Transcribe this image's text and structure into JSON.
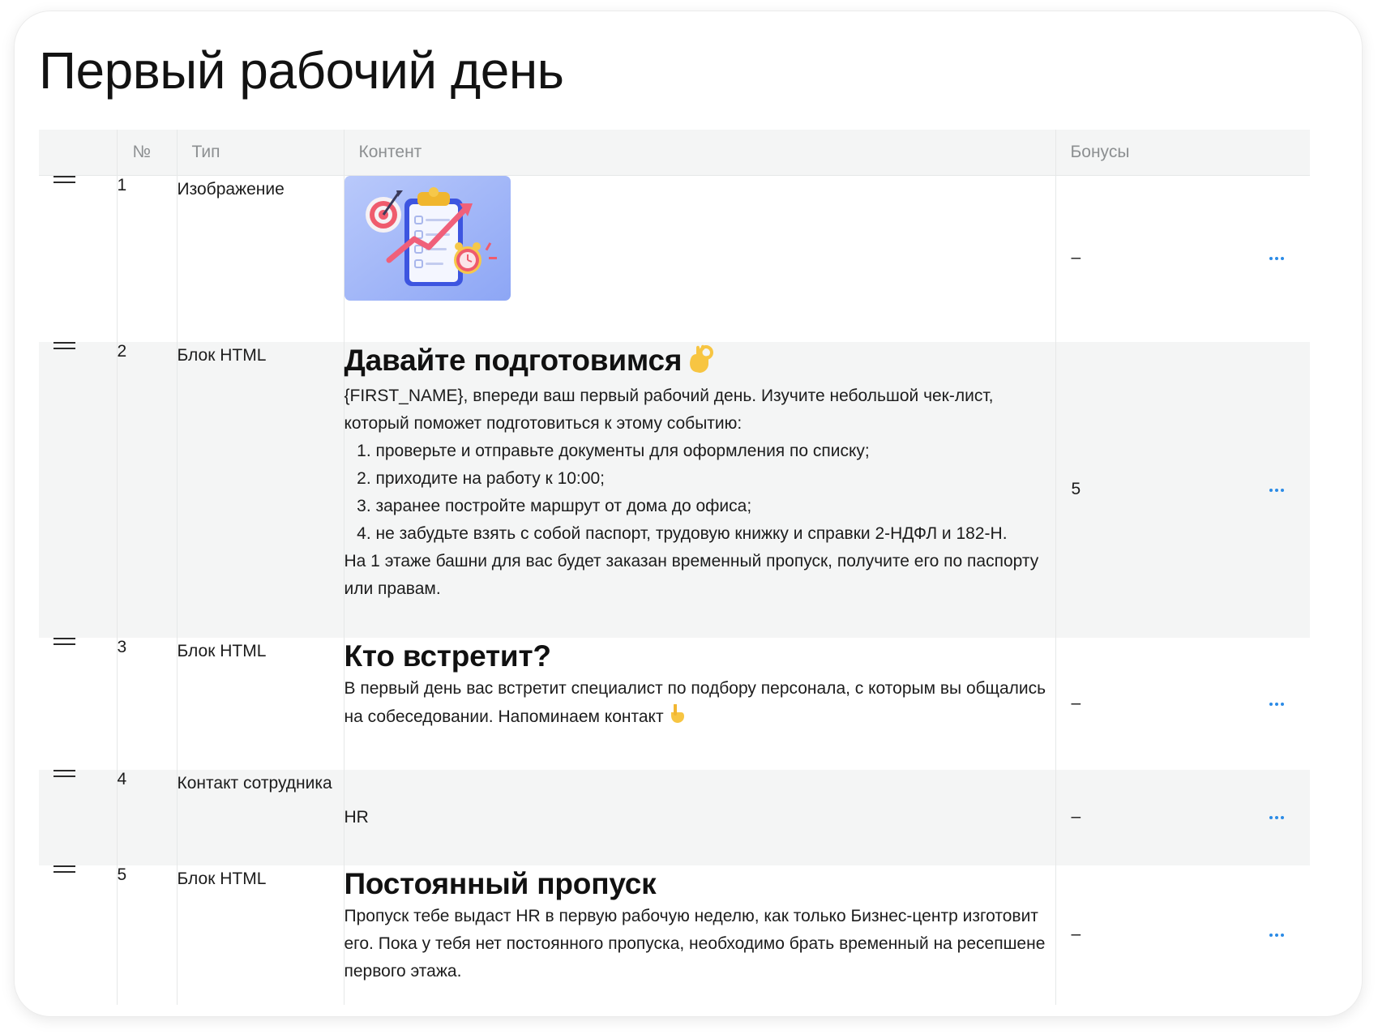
{
  "page": {
    "title": "Первый рабочий день"
  },
  "table": {
    "headers": {
      "num": "№",
      "type": "Тип",
      "content": "Контент",
      "bonuses": "Бонусы"
    },
    "rows": [
      {
        "num": "1",
        "type": "Изображение",
        "content_kind": "image",
        "image": "checklist-target-illustration",
        "bonus": "–"
      },
      {
        "num": "2",
        "type": "Блок HTML",
        "content_kind": "html",
        "title": "Давайте подготовимся",
        "title_emoji": "ok-hand-emoji",
        "intro": "{FIRST_NAME}, впереди ваш первый рабочий день. Изучите небольшой чек-лист, который поможет подготовиться к этому событию:",
        "list": [
          "проверьте и отправьте документы для оформления по списку;",
          "приходите на работу к 10:00;",
          "заранее постройте маршрут от дома до офиса;",
          "не забудьте взять с собой паспорт, трудовую книжку и справки 2-НДФЛ и 182-Н."
        ],
        "outro": "На 1 этаже башни для вас будет заказан временный пропуск, получите его по паспорту или правам.",
        "bonus": "5"
      },
      {
        "num": "3",
        "type": "Блок HTML",
        "content_kind": "html",
        "title": "Кто встретит?",
        "text": "В первый день вас встретит специалист по подбору персонала, с которым вы общались на собеседовании. Напоминаем контакт",
        "text_emoji": "pointing-down-emoji",
        "bonus": "–"
      },
      {
        "num": "4",
        "type": "Контакт сотрудника",
        "content_kind": "contact",
        "text": "HR",
        "bonus": "–"
      },
      {
        "num": "5",
        "type": "Блок HTML",
        "content_kind": "html",
        "title": "Постоянный пропуск",
        "text": "Пропуск тебе выдаст HR в первую рабочую неделю, как только Бизнес-центр изготовит его. Пока у тебя нет постоянного пропуска, необходимо брать временный на ресепшене первого этажа.",
        "bonus": "–"
      }
    ]
  },
  "colors": {
    "header_bg": "#f4f5f5",
    "alt_row_bg": "#f4f5f5",
    "border": "#e6e8e8",
    "accent_dots": "#2b8be6",
    "header_text": "#8c8f91"
  }
}
